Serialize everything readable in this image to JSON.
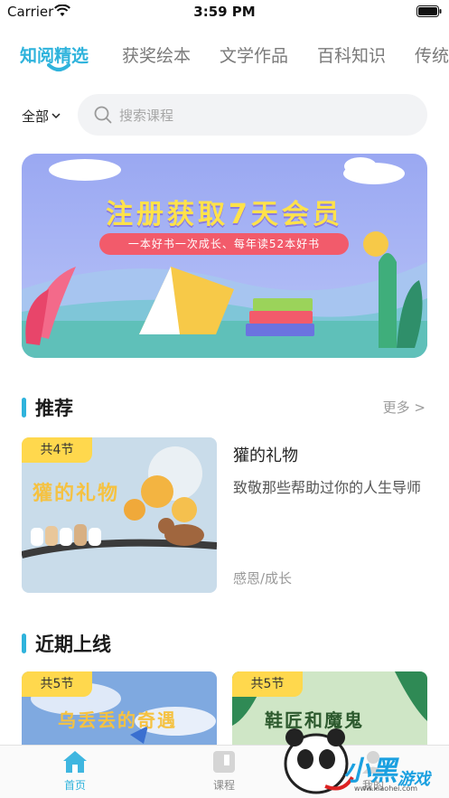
{
  "status_bar": {
    "carrier": "Carrier",
    "time": "3:59 PM"
  },
  "tabs": [
    {
      "label": "知阅精选",
      "active": true
    },
    {
      "label": "获奖绘本",
      "active": false
    },
    {
      "label": "文学作品",
      "active": false
    },
    {
      "label": "百科知识",
      "active": false
    },
    {
      "label": "传统",
      "active": false
    }
  ],
  "filter": {
    "label": "全部"
  },
  "search": {
    "placeholder": "搜索课程"
  },
  "banner": {
    "title": "注册获取7天会员",
    "subtitle": "一本好书一次成长、每年读52本好书"
  },
  "recommend": {
    "title": "推荐",
    "more": "更多 >",
    "course": {
      "badge": "共4节",
      "cover_title": "獾的礼物",
      "title": "獾的礼物",
      "description": "致敬那些帮助过你的人生导师",
      "tags": "感恩/成长"
    }
  },
  "recent": {
    "title": "近期上线",
    "courses": [
      {
        "badge": "共5节",
        "cover_title": "乌丢丢的奇遇"
      },
      {
        "badge": "共5节",
        "cover_title": "鞋匠和魔鬼"
      }
    ]
  },
  "bottom_nav": [
    {
      "label": "首页",
      "active": true
    },
    {
      "label": "课程",
      "active": false
    },
    {
      "label": "我的",
      "active": false
    }
  ],
  "watermark": {
    "brand_cn": "小黑",
    "brand_cn2": "游戏",
    "url": "www.xiaohei.com"
  },
  "colors": {
    "accent": "#2fb3dc",
    "badge": "#ffd84d",
    "banner_bg": "#8ea0f0"
  }
}
